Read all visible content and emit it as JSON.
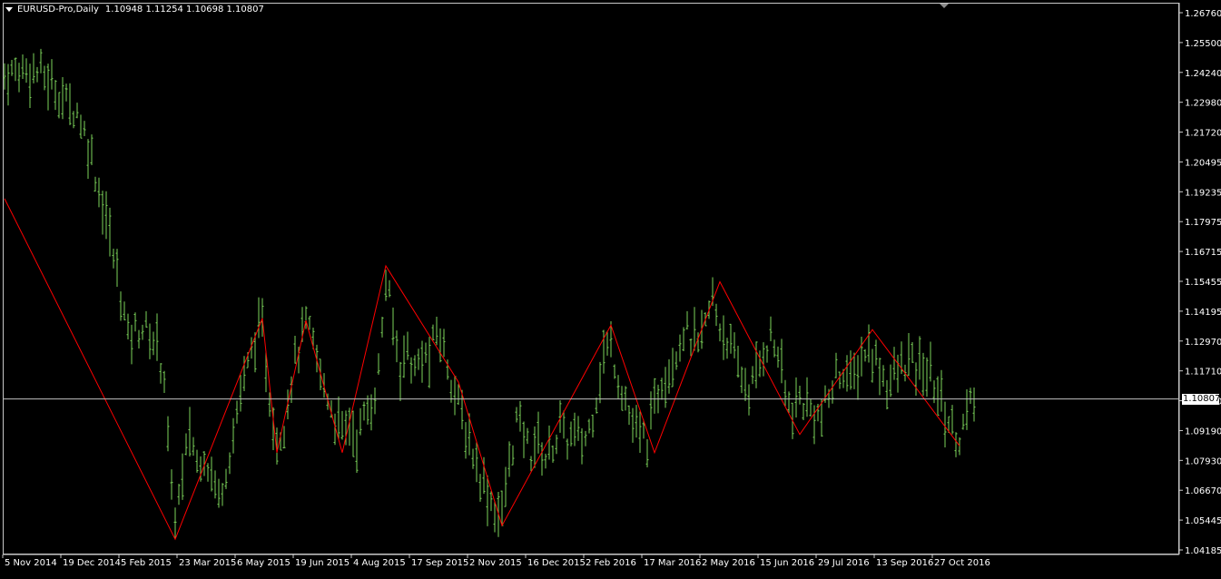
{
  "header": {
    "symbol_label": "EURUSD-Pro,Daily",
    "ohlc_values": "1.10948 1.11254 1.10698 1.10807"
  },
  "current_price_label": "1.10807",
  "colors": {
    "background": "#000000",
    "bars": "#7cd35a",
    "zigzag": "#ff0000",
    "price_line": "#c0c0c0",
    "axis_text": "#ffffff"
  },
  "chart_data": {
    "type": "line",
    "title": "EURUSD-Pro,Daily",
    "xlabel": "",
    "ylabel": "",
    "ylim": [
      1.0418,
      1.2776
    ],
    "grid": false,
    "y_ticks": [
      "1.26760",
      "1.25500",
      "1.24240",
      "1.22980",
      "1.21720",
      "1.20495",
      "1.19235",
      "1.17975",
      "1.16715",
      "1.15455",
      "1.14195",
      "1.12970",
      "1.11710",
      "1.10450",
      "1.09190",
      "1.07930",
      "1.06670",
      "1.05445",
      "1.04185"
    ],
    "x_ticks": [
      "5 Nov 2014",
      "19 Dec 2014",
      "5 Feb 2015",
      "23 Mar 2015",
      "6 May 2015",
      "19 Jun 2015",
      "4 Aug 2015",
      "17 Sep 2015",
      "2 Nov 2015",
      "16 Dec 2015",
      "2 Feb 2016",
      "17 Mar 2016",
      "2 May 2016",
      "15 Jun 2016",
      "29 Jul 2016",
      "13 Sep 2016",
      "27 Oct 2016"
    ],
    "current_price": 1.10807,
    "price_anchors": [
      [
        0,
        1.25
      ],
      [
        5,
        1.253
      ],
      [
        10,
        1.251
      ],
      [
        14,
        1.245
      ],
      [
        17,
        1.238
      ],
      [
        20,
        1.235
      ],
      [
        22,
        1.225
      ],
      [
        24,
        1.215
      ],
      [
        26,
        1.2
      ],
      [
        28,
        1.188
      ],
      [
        30,
        1.17
      ],
      [
        32,
        1.155
      ],
      [
        34,
        1.135
      ],
      [
        36,
        1.138
      ],
      [
        38,
        1.14
      ],
      [
        40,
        1.136
      ],
      [
        42,
        1.132
      ],
      [
        44,
        1.118
      ],
      [
        45,
        1.09
      ],
      [
        46,
        1.065
      ],
      [
        47,
        1.058
      ],
      [
        49,
        1.072
      ],
      [
        51,
        1.095
      ],
      [
        53,
        1.08
      ],
      [
        55,
        1.085
      ],
      [
        57,
        1.075
      ],
      [
        59,
        1.065
      ],
      [
        61,
        1.078
      ],
      [
        63,
        1.092
      ],
      [
        65,
        1.112
      ],
      [
        67,
        1.122
      ],
      [
        69,
        1.135
      ],
      [
        71,
        1.138
      ],
      [
        73,
        1.11
      ],
      [
        75,
        1.09
      ],
      [
        77,
        1.098
      ],
      [
        79,
        1.118
      ],
      [
        81,
        1.13
      ],
      [
        83,
        1.14
      ],
      [
        85,
        1.132
      ],
      [
        87,
        1.118
      ],
      [
        89,
        1.11
      ],
      [
        91,
        1.1
      ],
      [
        93,
        1.092
      ],
      [
        95,
        1.098
      ],
      [
        97,
        1.09
      ],
      [
        99,
        1.1
      ],
      [
        101,
        1.105
      ],
      [
        103,
        1.12
      ],
      [
        105,
        1.16
      ],
      [
        107,
        1.14
      ],
      [
        109,
        1.122
      ],
      [
        111,
        1.13
      ],
      [
        113,
        1.12
      ],
      [
        115,
        1.128
      ],
      [
        117,
        1.125
      ],
      [
        119,
        1.138
      ],
      [
        121,
        1.13
      ],
      [
        123,
        1.118
      ],
      [
        125,
        1.105
      ],
      [
        127,
        1.095
      ],
      [
        129,
        1.085
      ],
      [
        131,
        1.075
      ],
      [
        133,
        1.068
      ],
      [
        135,
        1.06
      ],
      [
        137,
        1.057
      ],
      [
        139,
        1.08
      ],
      [
        141,
        1.098
      ],
      [
        143,
        1.092
      ],
      [
        145,
        1.085
      ],
      [
        147,
        1.09
      ],
      [
        149,
        1.082
      ],
      [
        151,
        1.088
      ],
      [
        153,
        1.095
      ],
      [
        155,
        1.09
      ],
      [
        157,
        1.092
      ],
      [
        159,
        1.088
      ],
      [
        161,
        1.095
      ],
      [
        163,
        1.11
      ],
      [
        165,
        1.128
      ],
      [
        167,
        1.132
      ],
      [
        169,
        1.118
      ],
      [
        171,
        1.108
      ],
      [
        173,
        1.095
      ],
      [
        175,
        1.092
      ],
      [
        177,
        1.09
      ],
      [
        179,
        1.105
      ],
      [
        181,
        1.118
      ],
      [
        183,
        1.122
      ],
      [
        185,
        1.13
      ],
      [
        187,
        1.138
      ],
      [
        189,
        1.135
      ],
      [
        191,
        1.13
      ],
      [
        193,
        1.14
      ],
      [
        195,
        1.152
      ],
      [
        197,
        1.14
      ],
      [
        199,
        1.135
      ],
      [
        201,
        1.125
      ],
      [
        203,
        1.118
      ],
      [
        205,
        1.112
      ],
      [
        207,
        1.118
      ],
      [
        209,
        1.13
      ],
      [
        211,
        1.135
      ],
      [
        213,
        1.128
      ],
      [
        215,
        1.11
      ],
      [
        217,
        1.102
      ],
      [
        219,
        1.108
      ],
      [
        221,
        1.105
      ],
      [
        223,
        1.102
      ],
      [
        225,
        1.1
      ],
      [
        227,
        1.108
      ],
      [
        229,
        1.118
      ],
      [
        231,
        1.122
      ],
      [
        233,
        1.115
      ],
      [
        235,
        1.122
      ],
      [
        237,
        1.13
      ],
      [
        239,
        1.128
      ],
      [
        241,
        1.122
      ],
      [
        243,
        1.115
      ],
      [
        245,
        1.118
      ],
      [
        247,
        1.122
      ],
      [
        249,
        1.125
      ],
      [
        251,
        1.12
      ],
      [
        253,
        1.122
      ],
      [
        255,
        1.118
      ],
      [
        257,
        1.112
      ],
      [
        259,
        1.102
      ],
      [
        261,
        1.095
      ],
      [
        263,
        1.092
      ],
      [
        265,
        1.1
      ],
      [
        267,
        1.108
      ]
    ],
    "zigzag_points": [
      [
        0,
        1.196
      ],
      [
        47,
        1.0465
      ],
      [
        71,
        1.1435
      ],
      [
        75,
        1.0845
      ],
      [
        83,
        1.1425
      ],
      [
        93,
        1.0845
      ],
      [
        105,
        1.1665
      ],
      [
        125,
        1.1155
      ],
      [
        137,
        1.0525
      ],
      [
        167,
        1.1405
      ],
      [
        179,
        1.0845
      ],
      [
        197,
        1.1595
      ],
      [
        219,
        1.0925
      ],
      [
        239,
        1.1385
      ],
      [
        263,
        1.0875
      ]
    ],
    "bar_count": 268
  }
}
